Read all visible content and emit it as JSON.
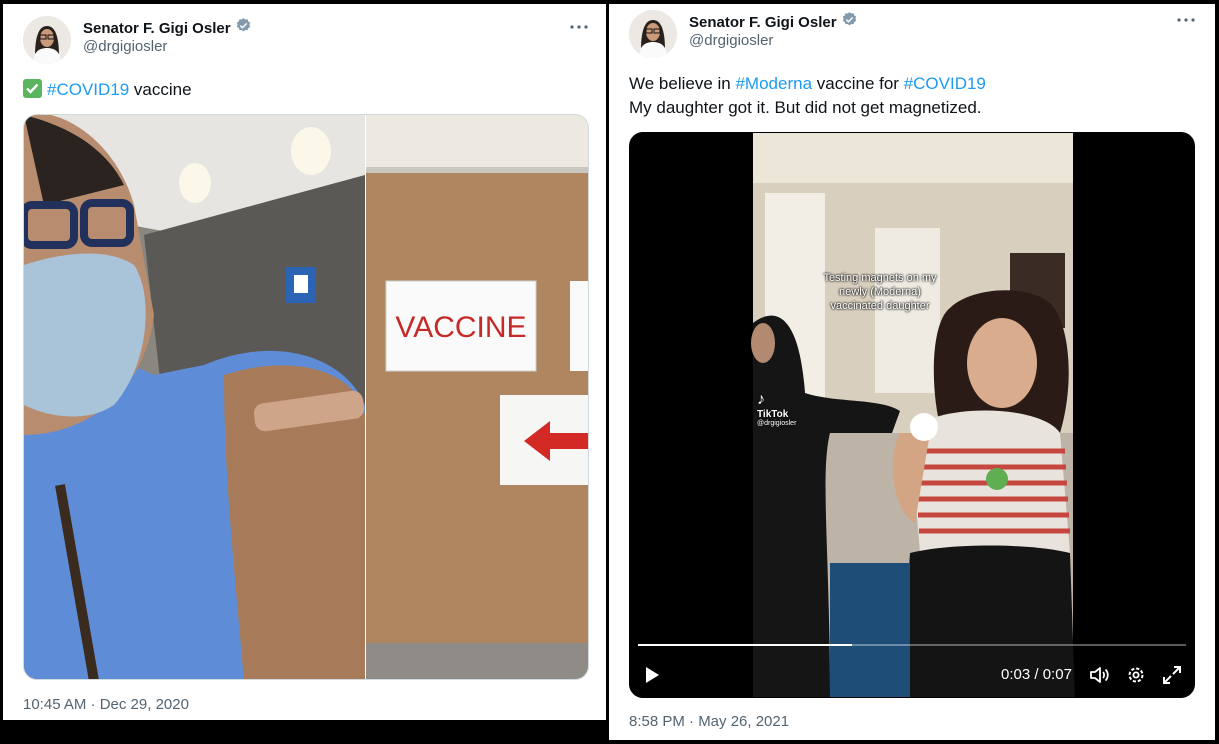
{
  "tweets": [
    {
      "author": {
        "name": "Senator F. Gigi Osler",
        "handle": "@drgigiosler",
        "verified": true
      },
      "text": {
        "emoji": "✅",
        "hashtag": "#COVID19",
        "rest": " vaccine"
      },
      "photo_sign": "VACCINE",
      "timestamp": "10:45 AM · Dec 29, 2020"
    },
    {
      "author": {
        "name": "Senator F. Gigi Osler",
        "handle": "@drgigiosler",
        "verified": true
      },
      "text": {
        "line1_pre": "We believe in ",
        "hashtag1": "#Moderna",
        "line1_mid": " vaccine for ",
        "hashtag2": "#COVID19",
        "line2": "My daughter got it. But did not get magnetized."
      },
      "video": {
        "caption": [
          "Testing magnets on my",
          "newly (Moderna)",
          "vaccinated daughter"
        ],
        "watermark_brand": "TikTok",
        "watermark_handle": "@drgigiosler",
        "current_time": "0:03",
        "separator": " / ",
        "duration": "0:07",
        "progress": 0.39
      },
      "timestamp": "8:58 PM · May 26, 2021"
    }
  ],
  "colors": {
    "accent": "#1d9bf0",
    "verified": "#829aab",
    "muted": "#536471",
    "check": "#5ab55e"
  },
  "icons": [
    "verified-badge-icon",
    "more-icon",
    "check-mark-icon",
    "play-icon",
    "volume-icon",
    "settings-icon",
    "fullscreen-icon"
  ]
}
